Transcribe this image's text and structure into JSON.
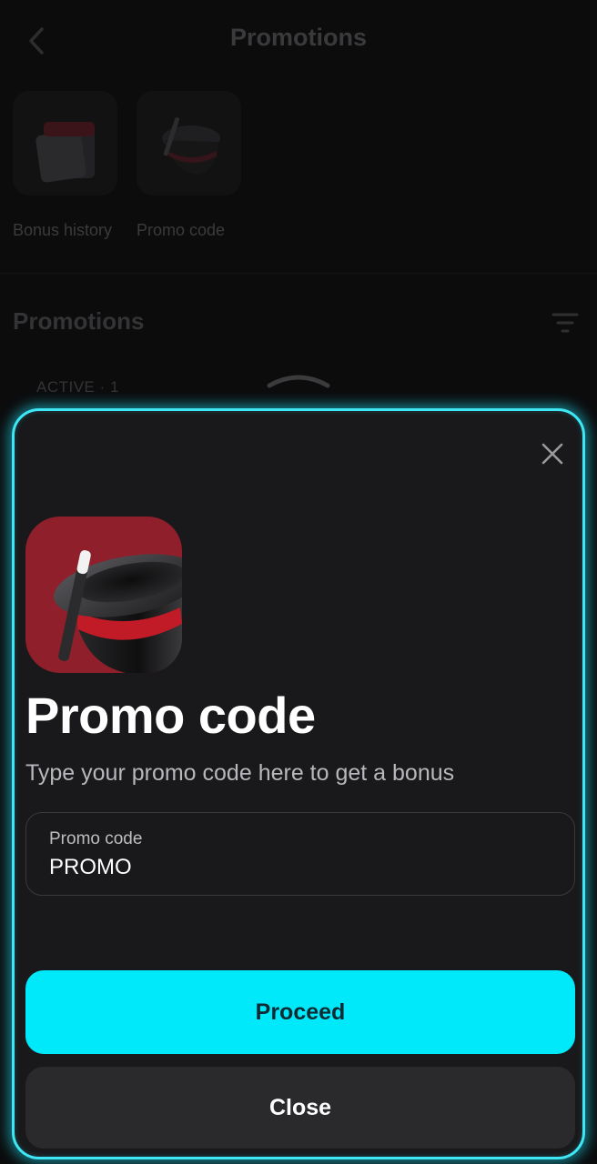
{
  "header": {
    "title": "Promotions",
    "back_icon": "chevron-left-icon"
  },
  "shortcuts": [
    {
      "label": "Bonus history",
      "icon": "calendar-icon"
    },
    {
      "label": "Promo code",
      "icon": "magic-hat-icon"
    }
  ],
  "section": {
    "title": "Promotions",
    "filter_icon": "filter-icon",
    "active_label": "ACTIVE · 1"
  },
  "modal": {
    "close_icon": "close-icon",
    "art_icon": "magic-hat-icon",
    "title": "Promo code",
    "subtitle": "Type your promo code here to get a bonus",
    "field": {
      "label": "Promo code",
      "value": "PROMO"
    },
    "proceed_label": "Proceed",
    "close_label": "Close"
  },
  "colors": {
    "accent": "#00e9fb",
    "glow_border": "#3fe6f4",
    "sheet_bg": "#19191b",
    "art_bg": "#8e1f2b"
  }
}
